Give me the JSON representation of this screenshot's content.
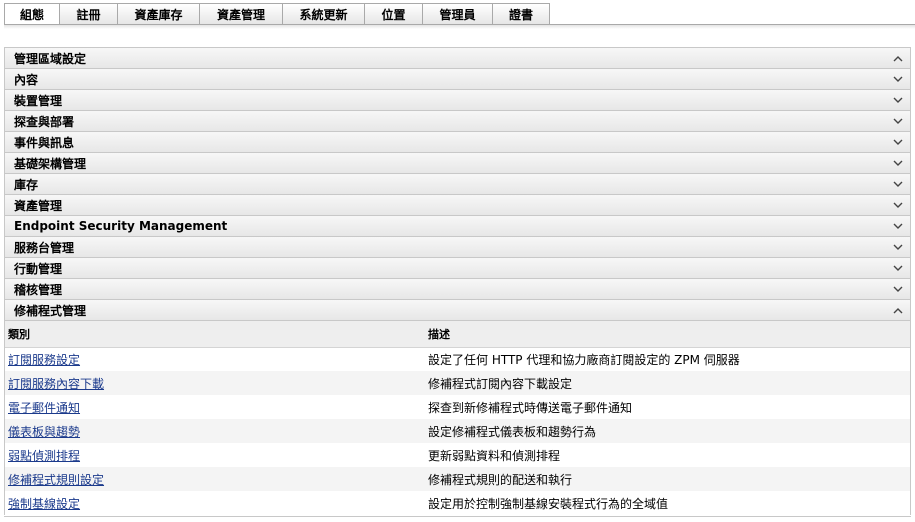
{
  "tabs": [
    {
      "label": "組態",
      "active": true
    },
    {
      "label": "註冊",
      "active": false
    },
    {
      "label": "資產庫存",
      "active": false
    },
    {
      "label": "資產管理",
      "active": false
    },
    {
      "label": "系統更新",
      "active": false
    },
    {
      "label": "位置",
      "active": false
    },
    {
      "label": "管理員",
      "active": false
    },
    {
      "label": "證書",
      "active": false
    }
  ],
  "sections": [
    {
      "title": "管理區域設定",
      "expanded": false,
      "icon": "chevron-up-icon"
    },
    {
      "title": "內容",
      "expanded": false,
      "icon": "chevron-down-icon"
    },
    {
      "title": "裝置管理",
      "expanded": false,
      "icon": "chevron-down-icon"
    },
    {
      "title": "探查與部署",
      "expanded": false,
      "icon": "chevron-down-icon"
    },
    {
      "title": "事件與訊息",
      "expanded": false,
      "icon": "chevron-down-icon"
    },
    {
      "title": "基礎架構管理",
      "expanded": false,
      "icon": "chevron-down-icon"
    },
    {
      "title": "庫存",
      "expanded": false,
      "icon": "chevron-down-icon"
    },
    {
      "title": "資產管理",
      "expanded": false,
      "icon": "chevron-down-icon"
    },
    {
      "title": "Endpoint Security Management",
      "expanded": false,
      "icon": "chevron-down-icon"
    },
    {
      "title": "服務台管理",
      "expanded": false,
      "icon": "chevron-down-icon"
    },
    {
      "title": "行動管理",
      "expanded": false,
      "icon": "chevron-down-icon"
    },
    {
      "title": "稽核管理",
      "expanded": false,
      "icon": "chevron-down-icon"
    },
    {
      "title": "修補程式管理",
      "expanded": true,
      "icon": "chevron-up-icon"
    }
  ],
  "patch_table": {
    "columns": [
      "類別",
      "描述"
    ],
    "rows": [
      {
        "category": "訂閱服務設定",
        "description": "設定了任何 HTTP 代理和協力廠商訂閱設定的 ZPM 伺服器"
      },
      {
        "category": "訂閱服務內容下載",
        "description": "修補程式訂閱內容下載設定"
      },
      {
        "category": "電子郵件通知",
        "description": "探查到新修補程式時傳送電子郵件通知"
      },
      {
        "category": "儀表板與趨勢",
        "description": "設定修補程式儀表板和趨勢行為"
      },
      {
        "category": "弱點偵測排程",
        "description": "更新弱點資料和偵測排程"
      },
      {
        "category": "修補程式規則設定",
        "description": "修補程式規則的配送和執行"
      },
      {
        "category": "強制基線設定",
        "description": "設定用於控制強制基線安裝程式行為的全域值"
      }
    ]
  },
  "colors": {
    "link": "#1b3a8c",
    "border": "#c8c8c8",
    "header_bg": "#eeeeee"
  }
}
